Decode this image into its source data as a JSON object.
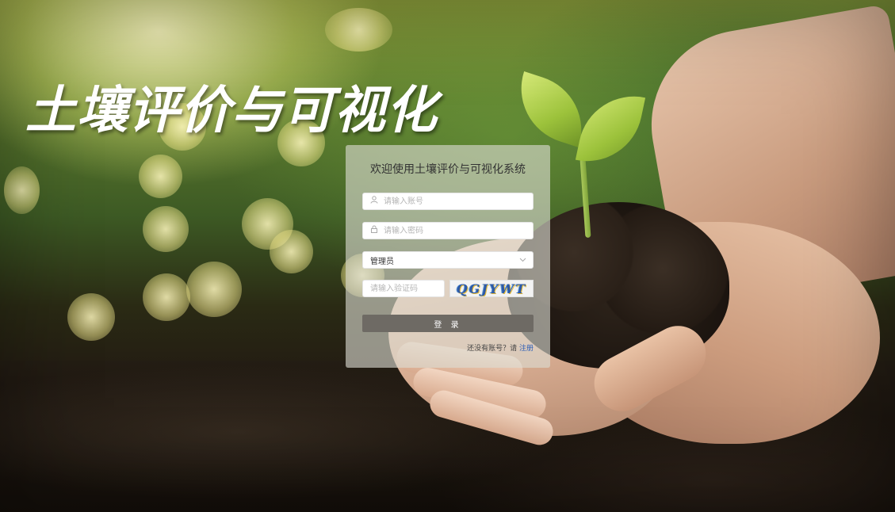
{
  "app_title": "土壤评价与可视化",
  "login": {
    "heading": "欢迎使用土壤评价与可视化系统",
    "username_placeholder": "请输入账号",
    "password_placeholder": "请输入密码",
    "role_selected": "管理员",
    "captcha_placeholder": "请输入验证码",
    "captcha_text": "QGJYWT",
    "login_button": "登 录",
    "no_account_text": "还没有账号？请",
    "register_link": "注册"
  },
  "icons": {
    "user": "user-icon",
    "lock": "lock-icon",
    "dropdown": "chevron-down-icon"
  },
  "colors": {
    "panel_bg": "#dcdcd2",
    "login_button_bg": "#6e6a64",
    "register_link": "#2a5db8"
  }
}
